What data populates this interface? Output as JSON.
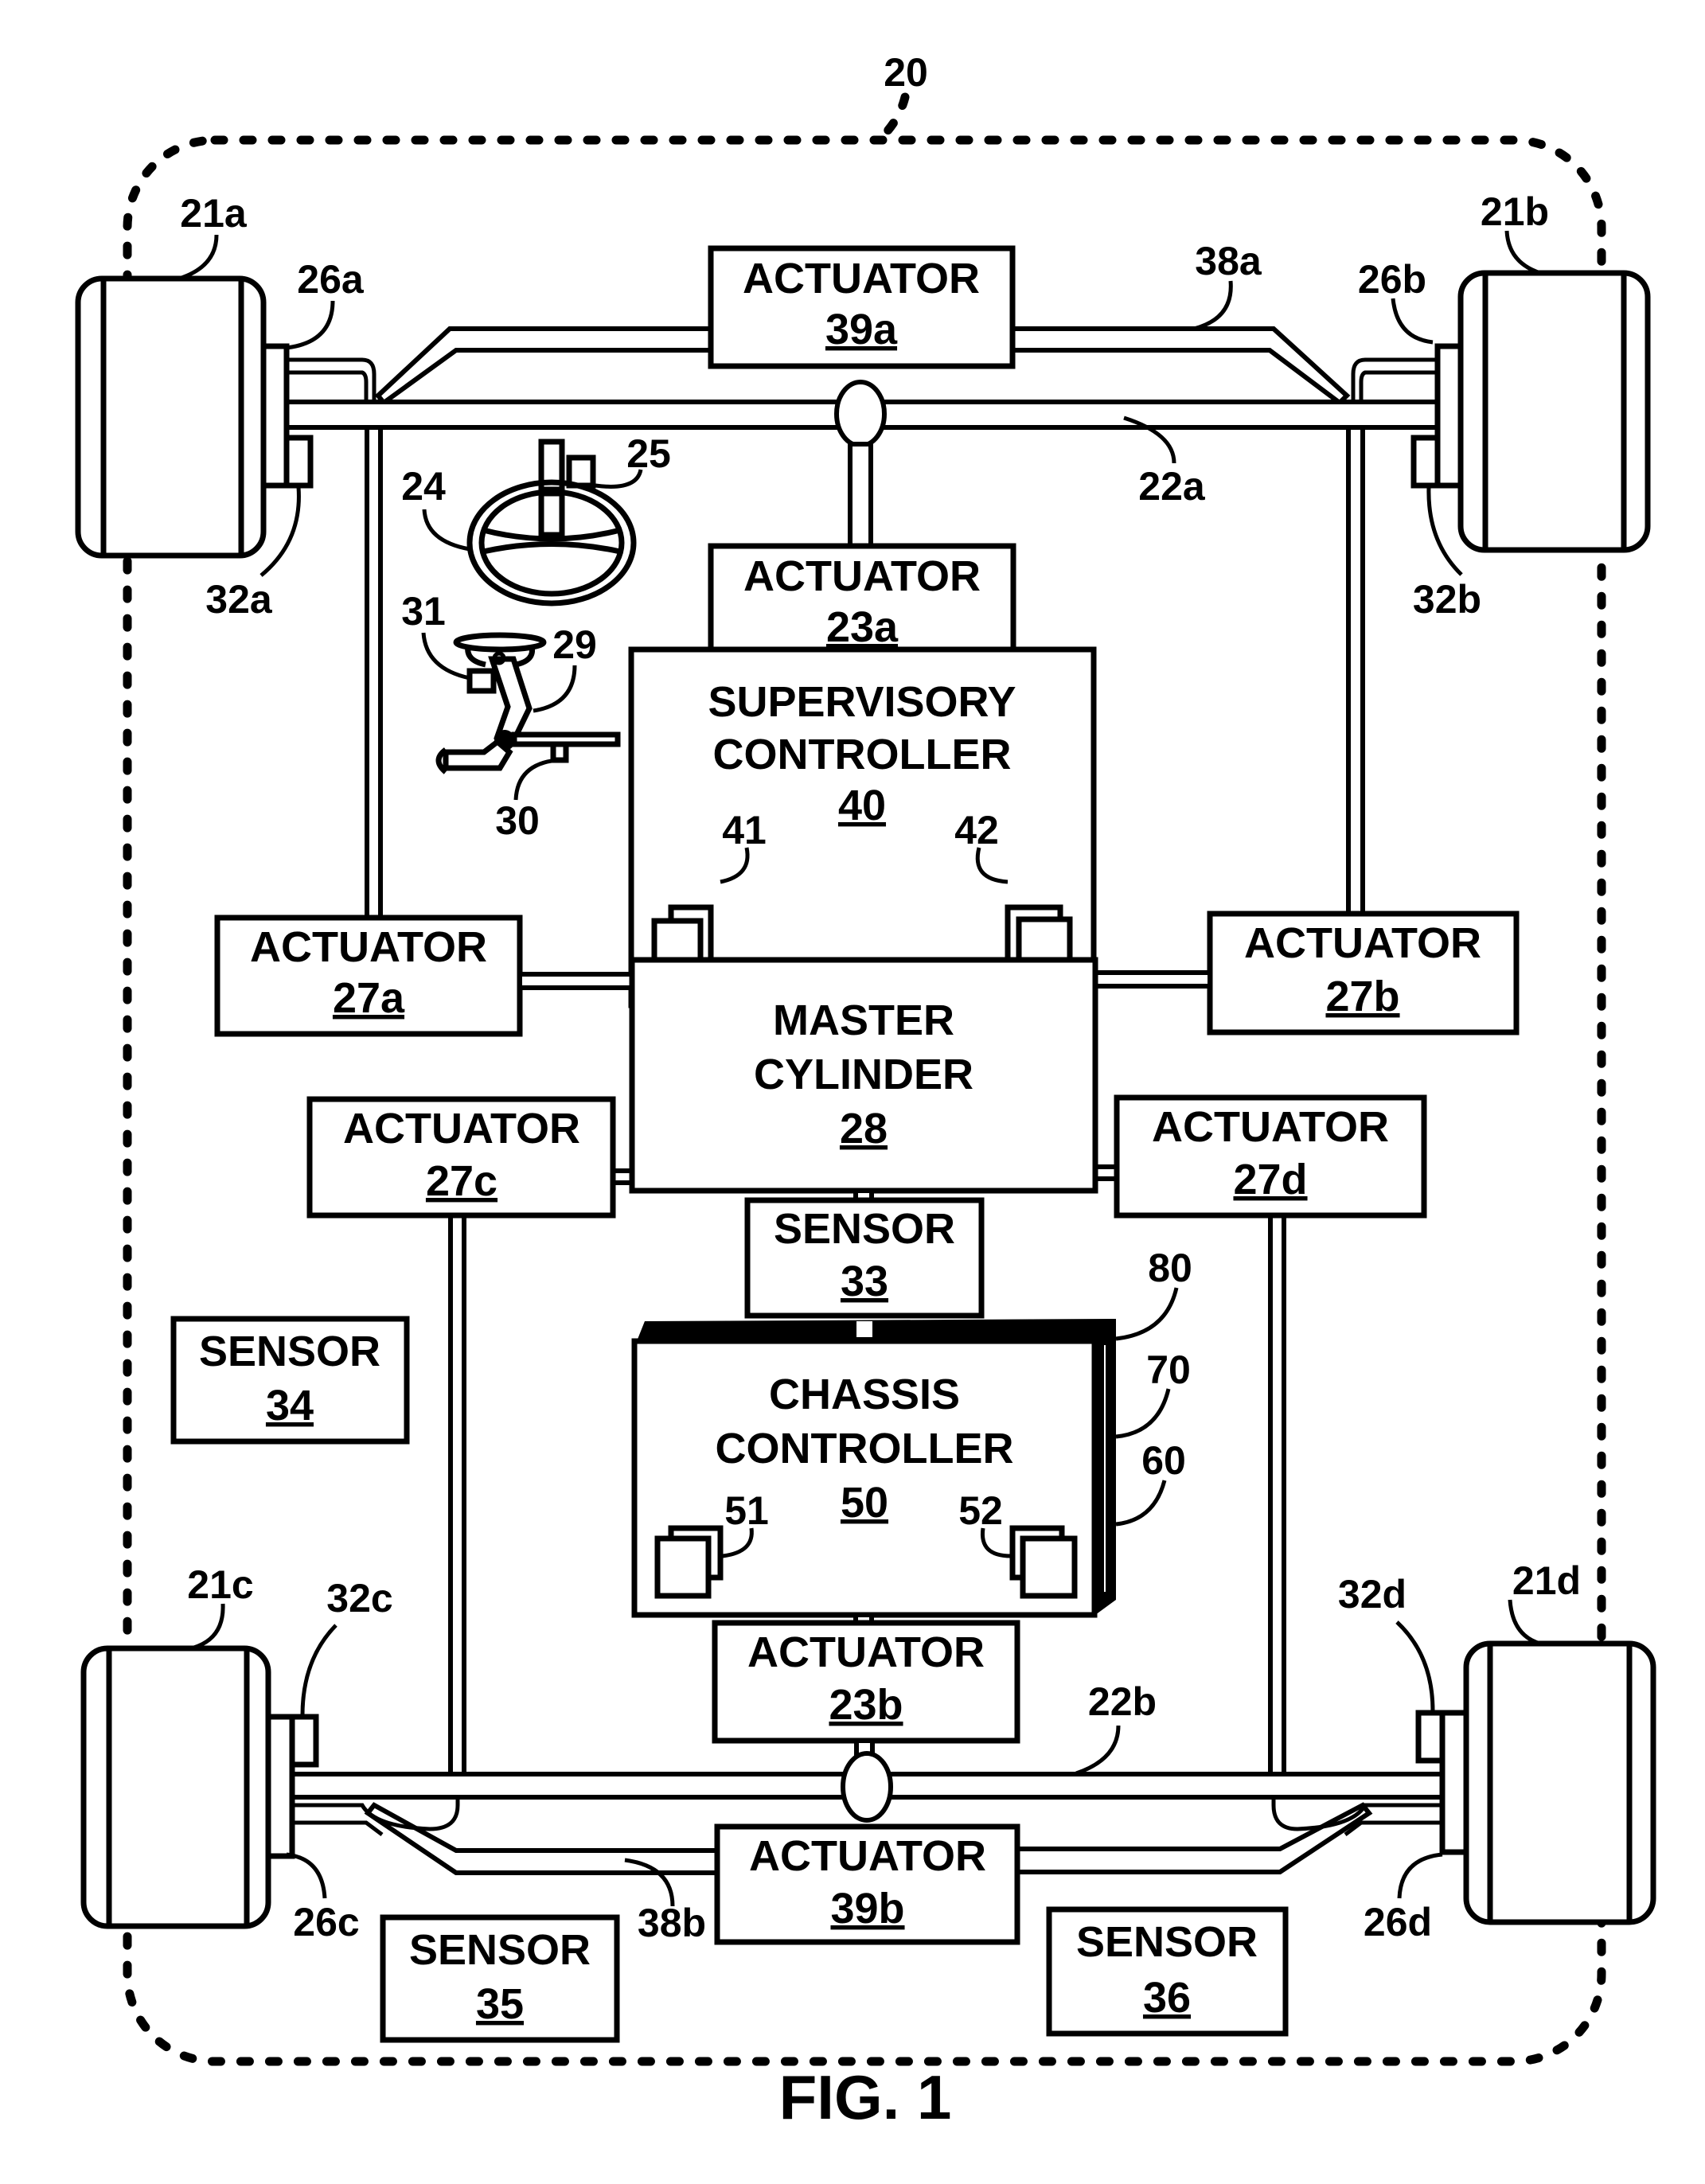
{
  "figure": {
    "caption": "FIG. 1",
    "system_ref": "20",
    "colors": {
      "ink": "#000000",
      "paper": "#ffffff"
    }
  },
  "boxes": {
    "actuator_39a": {
      "title": "ACTUATOR",
      "ref": "39a"
    },
    "actuator_23a": {
      "title": "ACTUATOR",
      "ref": "23a"
    },
    "supervisory": {
      "line1": "SUPERVISORY",
      "line2": "CONTROLLER",
      "ref": "40",
      "sub_left": "41",
      "sub_right": "42"
    },
    "actuator_27a": {
      "title": "ACTUATOR",
      "ref": "27a"
    },
    "actuator_27b": {
      "title": "ACTUATOR",
      "ref": "27b"
    },
    "master_cylinder": {
      "line1": "MASTER",
      "line2": "CYLINDER",
      "ref": "28"
    },
    "actuator_27c": {
      "title": "ACTUATOR",
      "ref": "27c"
    },
    "actuator_27d": {
      "title": "ACTUATOR",
      "ref": "27d"
    },
    "sensor_33": {
      "title": "SENSOR",
      "ref": "33"
    },
    "sensor_34": {
      "title": "SENSOR",
      "ref": "34"
    },
    "chassis": {
      "line1": "CHASSIS",
      "line2": "CONTROLLER",
      "ref": "50",
      "sub_left": "51",
      "sub_right": "52",
      "layers": [
        "80",
        "70",
        "60"
      ]
    },
    "actuator_23b": {
      "title": "ACTUATOR",
      "ref": "23b"
    },
    "actuator_39b": {
      "title": "ACTUATOR",
      "ref": "39b"
    },
    "sensor_35": {
      "title": "SENSOR",
      "ref": "35"
    },
    "sensor_36": {
      "title": "SENSOR",
      "ref": "36"
    }
  },
  "labels": {
    "wheel_fl": "21a",
    "wheel_fr": "21b",
    "wheel_rl": "21c",
    "wheel_rr": "21d",
    "brake_fl": "26a",
    "brake_fr": "26b",
    "brake_rl": "26c",
    "brake_rr": "26d",
    "wheel_sensor_fl": "32a",
    "wheel_sensor_fr": "32b",
    "wheel_sensor_rl": "32c",
    "wheel_sensor_rr": "32d",
    "front_axle": "22a",
    "rear_axle": "22b",
    "front_stabilizer": "38a",
    "rear_stabilizer": "38b",
    "steering_wheel": "24",
    "steering_sensor": "25",
    "brake_pedal": "29",
    "pedal_sensor": "30",
    "pedal_sensor_b": "31"
  }
}
